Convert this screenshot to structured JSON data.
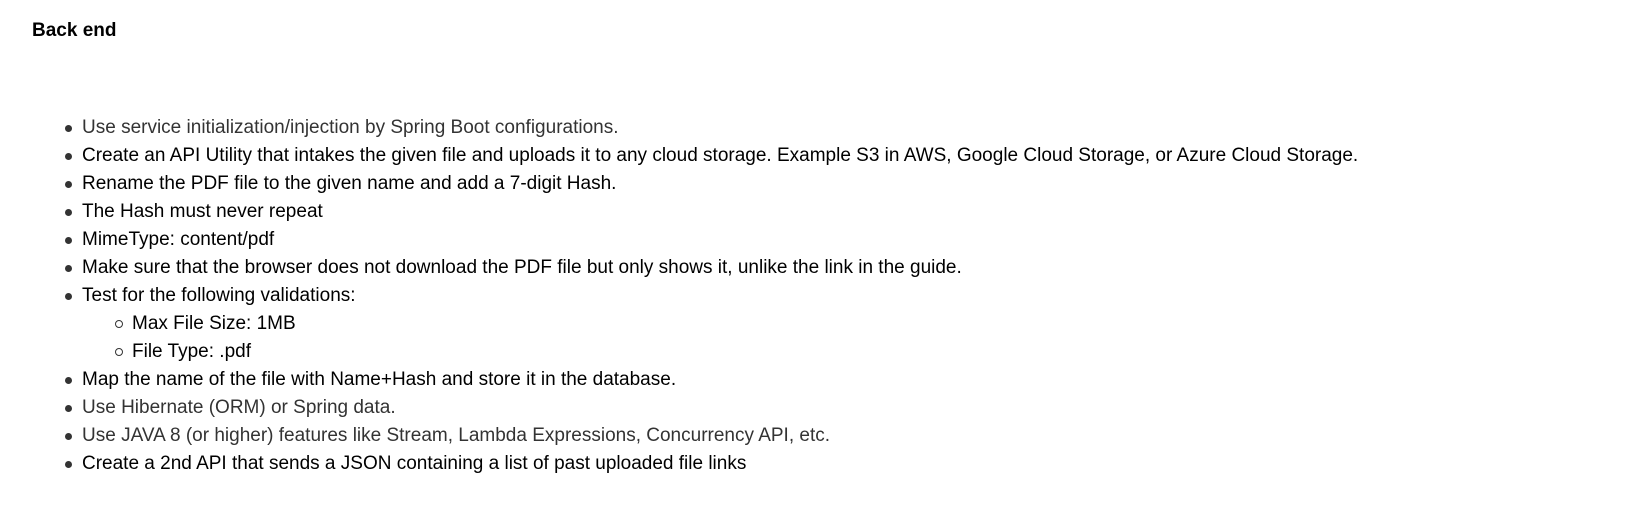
{
  "section": {
    "title": "Back end"
  },
  "requirements": [
    {
      "text": "Use service initialization/injection by Spring Boot configurations."
    },
    {
      "text": "Create an API Utility that intakes the given file and uploads it to any cloud storage. Example S3 in AWS, Google Cloud Storage, or Azure Cloud Storage."
    },
    {
      "text": "Rename the PDF file to the given name and add a 7-digit Hash."
    },
    {
      "text": "The Hash must never repeat"
    },
    {
      "text": "MimeType: content/pdf"
    },
    {
      "text": "Make sure that the browser does not download the PDF file but only shows it, unlike the link in the guide."
    },
    {
      "text": "Test for the following validations:",
      "subitems": [
        "Max File Size: 1MB",
        "File Type: .pdf"
      ]
    },
    {
      "text": "Map the name of the file with Name+Hash and store it in the database."
    },
    {
      "text": "Use Hibernate (ORM) or Spring data."
    },
    {
      "text": "Use JAVA 8 (or higher) features like Stream, Lambda Expressions, Concurrency API, etc."
    },
    {
      "text": "Create a 2nd API that sends a JSON containing a list of past uploaded file links"
    }
  ]
}
